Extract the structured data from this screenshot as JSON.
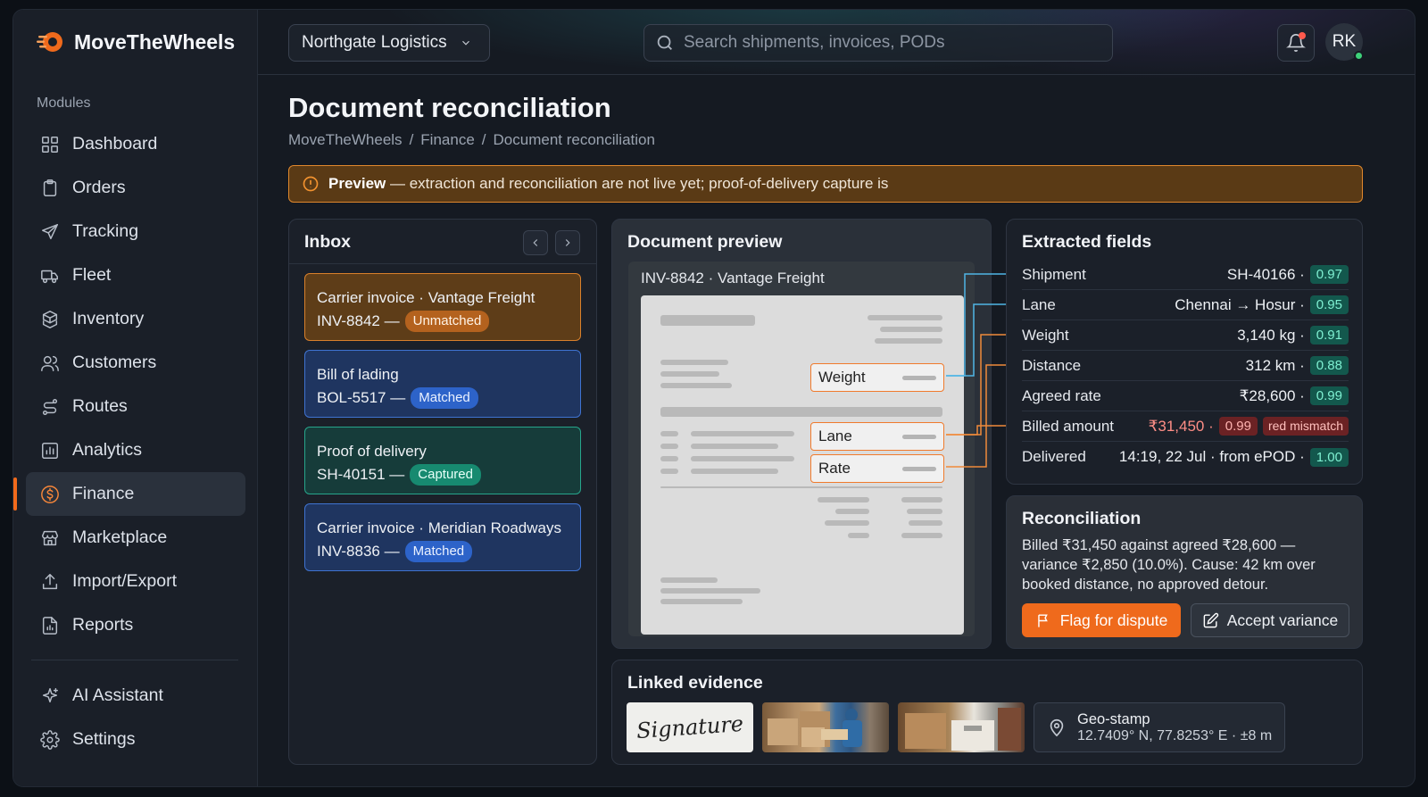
{
  "app": {
    "brand": "MoveTheWheels"
  },
  "sidebar": {
    "section_label": "Modules",
    "items": [
      {
        "label": "Dashboard",
        "icon": "grid-icon"
      },
      {
        "label": "Orders",
        "icon": "clipboard-icon"
      },
      {
        "label": "Tracking",
        "icon": "send-icon"
      },
      {
        "label": "Fleet",
        "icon": "truck-icon"
      },
      {
        "label": "Inventory",
        "icon": "boxes-icon"
      },
      {
        "label": "Customers",
        "icon": "users-icon"
      },
      {
        "label": "Routes",
        "icon": "route-icon"
      },
      {
        "label": "Analytics",
        "icon": "bar-chart-icon"
      },
      {
        "label": "Finance",
        "icon": "dollar-icon",
        "active": true
      },
      {
        "label": "Marketplace",
        "icon": "store-icon"
      },
      {
        "label": "Import/Export",
        "icon": "upload-icon"
      },
      {
        "label": "Reports",
        "icon": "report-icon"
      }
    ],
    "bottom_items": [
      {
        "label": "AI Assistant",
        "icon": "sparkle-icon"
      },
      {
        "label": "Settings",
        "icon": "gear-icon"
      }
    ]
  },
  "topbar": {
    "org": "Northgate Logistics",
    "search_placeholder": "Search shipments, invoices, PODs",
    "avatar_initials": "RK"
  },
  "page": {
    "title": "Document reconciliation",
    "breadcrumb": [
      "MoveTheWheels",
      "/",
      "Finance",
      "/",
      "Document reconciliation"
    ],
    "banner_bold": "Preview",
    "banner_text": " — extraction and reconciliation are not live yet; proof-of-delivery capture is"
  },
  "inbox": {
    "title": "Inbox",
    "cards": [
      {
        "title": "Carrier invoice · Vantage Freight",
        "ref": "INV-8842 —",
        "status": "Unmatched"
      },
      {
        "title": "Bill of lading",
        "ref": "BOL-5517 —",
        "status": "Matched"
      },
      {
        "title": "Proof of delivery",
        "ref": "SH-40151 —",
        "status": "Captured"
      },
      {
        "title": "Carrier invoice · Meridian Roadways",
        "ref": "INV-8836 —",
        "status": "Matched"
      }
    ]
  },
  "preview": {
    "title": "Document preview",
    "doc_title": "INV-8842 · Vantage Freight",
    "highlights": {
      "weight": "Weight",
      "lane": "Lane",
      "rate": "Rate"
    }
  },
  "extracted": {
    "title": "Extracted fields",
    "fields": [
      {
        "label": "Shipment",
        "value": "SH-40166 ·",
        "confidence": "0.97"
      },
      {
        "label": "Lane",
        "value": "Chennai → Hosur ·",
        "confidence": "0.95"
      },
      {
        "label": "Weight",
        "value": "3,140 kg ·",
        "confidence": "0.91"
      },
      {
        "label": "Distance",
        "value": "312 km ·",
        "confidence": "0.88"
      },
      {
        "label": "Agreed rate",
        "value": "₹28,600 ·",
        "confidence": "0.99"
      },
      {
        "label": "Billed amount",
        "value": "₹31,450 ·",
        "confidence": "0.99",
        "flag": "red mismatch"
      },
      {
        "label": "Delivered",
        "value": "14:19, 22 Jul · from ePOD ·",
        "confidence": "1.00"
      }
    ],
    "colors": {
      "link_line_blue": "#4fb6e6",
      "link_line_orange": "#f08a3a"
    }
  },
  "reconciliation": {
    "title": "Reconciliation",
    "text": "Billed ₹31,450 against agreed ₹28,600 — variance ₹2,850 (10.0%). Cause: 42 km over booked distance, no approved detour.",
    "flag_button": "Flag for dispute",
    "accept_button": "Accept variance"
  },
  "evidence": {
    "title": "Linked evidence",
    "signature_text": "Signature",
    "geo_label": "Geo-stamp",
    "geo_value": "12.7409° N, 77.8253° E · ±8 m"
  },
  "colors": {
    "accent": "#ef6a1c",
    "matched": "#2d63c9",
    "captured": "#178a70",
    "unmatched": "#b4621e"
  }
}
